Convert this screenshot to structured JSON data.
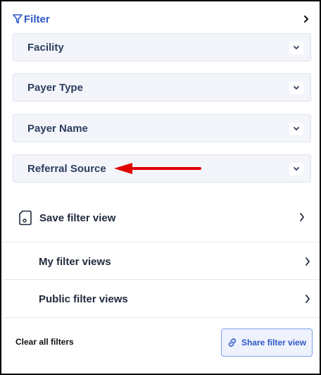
{
  "header": {
    "title": "Filter"
  },
  "accordions": [
    {
      "label": "Facility"
    },
    {
      "label": "Payer Type"
    },
    {
      "label": "Payer Name"
    },
    {
      "label": "Referral Source"
    }
  ],
  "actions": {
    "save_view": "Save filter view",
    "my_views": "My filter views",
    "public_views": "Public filter views"
  },
  "footer": {
    "clear_all": "Clear all filters",
    "share": "Share filter view"
  },
  "colors": {
    "accent": "#2f57c8",
    "annotation_arrow": "#e00000"
  }
}
